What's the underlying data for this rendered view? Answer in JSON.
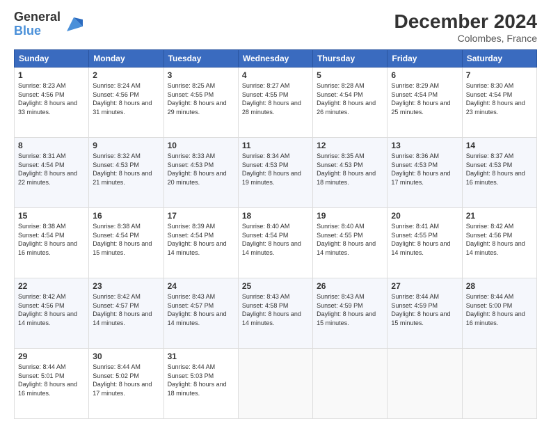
{
  "logo": {
    "general": "General",
    "blue": "Blue"
  },
  "header": {
    "month": "December 2024",
    "location": "Colombes, France"
  },
  "columns": [
    "Sunday",
    "Monday",
    "Tuesday",
    "Wednesday",
    "Thursday",
    "Friday",
    "Saturday"
  ],
  "weeks": [
    [
      {
        "day": "1",
        "sunrise": "8:23 AM",
        "sunset": "4:56 PM",
        "daylight": "8 hours and 33 minutes."
      },
      {
        "day": "2",
        "sunrise": "8:24 AM",
        "sunset": "4:56 PM",
        "daylight": "8 hours and 31 minutes."
      },
      {
        "day": "3",
        "sunrise": "8:25 AM",
        "sunset": "4:55 PM",
        "daylight": "8 hours and 29 minutes."
      },
      {
        "day": "4",
        "sunrise": "8:27 AM",
        "sunset": "4:55 PM",
        "daylight": "8 hours and 28 minutes."
      },
      {
        "day": "5",
        "sunrise": "8:28 AM",
        "sunset": "4:54 PM",
        "daylight": "8 hours and 26 minutes."
      },
      {
        "day": "6",
        "sunrise": "8:29 AM",
        "sunset": "4:54 PM",
        "daylight": "8 hours and 25 minutes."
      },
      {
        "day": "7",
        "sunrise": "8:30 AM",
        "sunset": "4:54 PM",
        "daylight": "8 hours and 23 minutes."
      }
    ],
    [
      {
        "day": "8",
        "sunrise": "8:31 AM",
        "sunset": "4:54 PM",
        "daylight": "8 hours and 22 minutes."
      },
      {
        "day": "9",
        "sunrise": "8:32 AM",
        "sunset": "4:53 PM",
        "daylight": "8 hours and 21 minutes."
      },
      {
        "day": "10",
        "sunrise": "8:33 AM",
        "sunset": "4:53 PM",
        "daylight": "8 hours and 20 minutes."
      },
      {
        "day": "11",
        "sunrise": "8:34 AM",
        "sunset": "4:53 PM",
        "daylight": "8 hours and 19 minutes."
      },
      {
        "day": "12",
        "sunrise": "8:35 AM",
        "sunset": "4:53 PM",
        "daylight": "8 hours and 18 minutes."
      },
      {
        "day": "13",
        "sunrise": "8:36 AM",
        "sunset": "4:53 PM",
        "daylight": "8 hours and 17 minutes."
      },
      {
        "day": "14",
        "sunrise": "8:37 AM",
        "sunset": "4:53 PM",
        "daylight": "8 hours and 16 minutes."
      }
    ],
    [
      {
        "day": "15",
        "sunrise": "8:38 AM",
        "sunset": "4:54 PM",
        "daylight": "8 hours and 16 minutes."
      },
      {
        "day": "16",
        "sunrise": "8:38 AM",
        "sunset": "4:54 PM",
        "daylight": "8 hours and 15 minutes."
      },
      {
        "day": "17",
        "sunrise": "8:39 AM",
        "sunset": "4:54 PM",
        "daylight": "8 hours and 14 minutes."
      },
      {
        "day": "18",
        "sunrise": "8:40 AM",
        "sunset": "4:54 PM",
        "daylight": "8 hours and 14 minutes."
      },
      {
        "day": "19",
        "sunrise": "8:40 AM",
        "sunset": "4:55 PM",
        "daylight": "8 hours and 14 minutes."
      },
      {
        "day": "20",
        "sunrise": "8:41 AM",
        "sunset": "4:55 PM",
        "daylight": "8 hours and 14 minutes."
      },
      {
        "day": "21",
        "sunrise": "8:42 AM",
        "sunset": "4:56 PM",
        "daylight": "8 hours and 14 minutes."
      }
    ],
    [
      {
        "day": "22",
        "sunrise": "8:42 AM",
        "sunset": "4:56 PM",
        "daylight": "8 hours and 14 minutes."
      },
      {
        "day": "23",
        "sunrise": "8:42 AM",
        "sunset": "4:57 PM",
        "daylight": "8 hours and 14 minutes."
      },
      {
        "day": "24",
        "sunrise": "8:43 AM",
        "sunset": "4:57 PM",
        "daylight": "8 hours and 14 minutes."
      },
      {
        "day": "25",
        "sunrise": "8:43 AM",
        "sunset": "4:58 PM",
        "daylight": "8 hours and 14 minutes."
      },
      {
        "day": "26",
        "sunrise": "8:43 AM",
        "sunset": "4:59 PM",
        "daylight": "8 hours and 15 minutes."
      },
      {
        "day": "27",
        "sunrise": "8:44 AM",
        "sunset": "4:59 PM",
        "daylight": "8 hours and 15 minutes."
      },
      {
        "day": "28",
        "sunrise": "8:44 AM",
        "sunset": "5:00 PM",
        "daylight": "8 hours and 16 minutes."
      }
    ],
    [
      {
        "day": "29",
        "sunrise": "8:44 AM",
        "sunset": "5:01 PM",
        "daylight": "8 hours and 16 minutes."
      },
      {
        "day": "30",
        "sunrise": "8:44 AM",
        "sunset": "5:02 PM",
        "daylight": "8 hours and 17 minutes."
      },
      {
        "day": "31",
        "sunrise": "8:44 AM",
        "sunset": "5:03 PM",
        "daylight": "8 hours and 18 minutes."
      },
      null,
      null,
      null,
      null
    ]
  ]
}
